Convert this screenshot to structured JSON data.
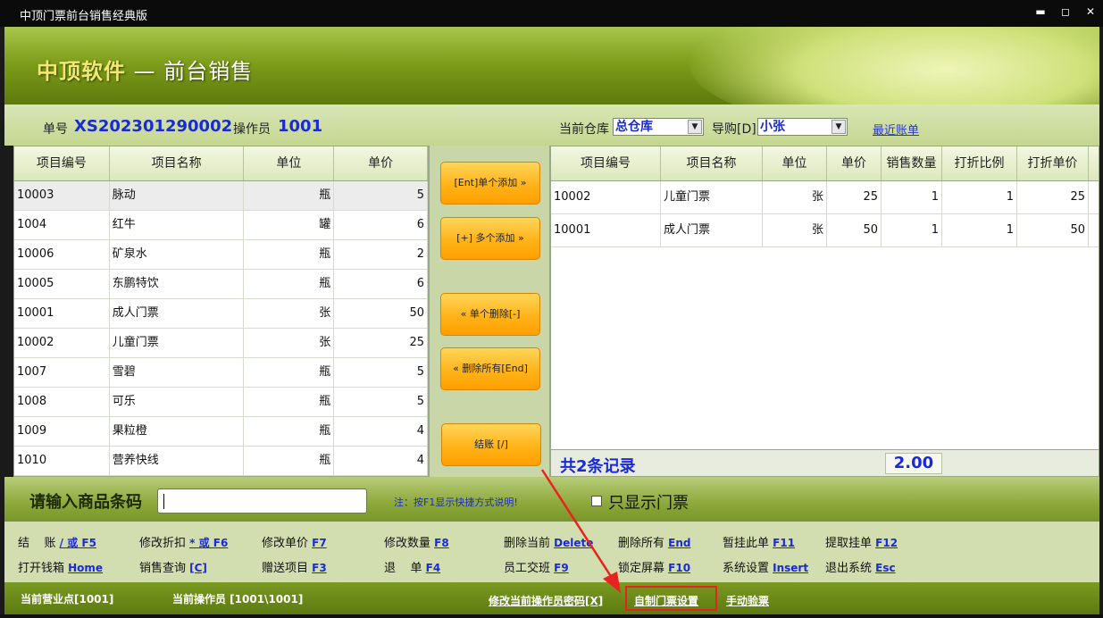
{
  "window": {
    "title": "中顶门票前台销售经典版",
    "buttons": [
      "▬",
      "◻",
      "✕"
    ]
  },
  "banner": {
    "logo_main": "中顶软件",
    "logo_sep": " — ",
    "logo_sub": "前台销售"
  },
  "info": {
    "order_label": "单号",
    "order_value": "XS202301290002",
    "operator_label": "操作员",
    "operator_value": "1001",
    "warehouse_label": "当前仓库",
    "warehouse_value": "总仓库",
    "guide_label": "导购[D]",
    "guide_value": "小张",
    "recent_link": "最近账单"
  },
  "left_grid": {
    "headers": [
      "项目编号",
      "项目名称",
      "单位",
      "单价"
    ],
    "rows": [
      [
        "10003",
        "脉动",
        "瓶",
        "5"
      ],
      [
        "1004",
        "红牛",
        "罐",
        "6"
      ],
      [
        "10006",
        "矿泉水",
        "瓶",
        "2"
      ],
      [
        "10005",
        "东鹏特饮",
        "瓶",
        "6"
      ],
      [
        "10001",
        "成人门票",
        "张",
        "50"
      ],
      [
        "10002",
        "儿童门票",
        "张",
        "25"
      ],
      [
        "1007",
        "雪碧",
        "瓶",
        "5"
      ],
      [
        "1008",
        "可乐",
        "瓶",
        "5"
      ],
      [
        "1009",
        "果粒橙",
        "瓶",
        "4"
      ],
      [
        "1010",
        "营养快线",
        "瓶",
        "4"
      ]
    ]
  },
  "mid_buttons": {
    "add_single": "[Ent]单个添加 »",
    "add_multi": "[+] 多个添加 »",
    "del_single": "« 单个删除[-]",
    "del_all": "« 删除所有[End]",
    "checkout": "结账 [/]"
  },
  "right_grid": {
    "headers": [
      "项目编号",
      "项目名称",
      "单位",
      "单价",
      "销售数量",
      "打折比例",
      "打折单价"
    ],
    "rows": [
      [
        "10002",
        "儿童门票",
        "张",
        "25",
        "1",
        "1",
        "25"
      ],
      [
        "10001",
        "成人门票",
        "张",
        "50",
        "1",
        "1",
        "50"
      ]
    ],
    "record_count": "共2条记录",
    "total": "2.00"
  },
  "barcode": {
    "label": "请输入商品条码",
    "value": "",
    "note": "注：按F1显示快捷方式说明!",
    "only_tickets_label": "只显示门票",
    "only_tickets_checked": false
  },
  "shortcuts": {
    "row1": [
      {
        "label": "结    账 ",
        "key": "/ 或 F5"
      },
      {
        "label": "修改折扣 ",
        "key": "* 或 F6"
      },
      {
        "label": "修改单价 ",
        "key": "F7"
      },
      {
        "label": "修改数量 ",
        "key": "F8"
      },
      {
        "label": "删除当前 ",
        "key": "Delete"
      },
      {
        "label": "删除所有 ",
        "key": "End"
      },
      {
        "label": "暂挂此单 ",
        "key": "F11"
      },
      {
        "label": "提取挂单 ",
        "key": "F12"
      }
    ],
    "row2": [
      {
        "label": "打开钱箱 ",
        "key": "Home"
      },
      {
        "label": "销售查询 ",
        "key": "[C]"
      },
      {
        "label": "赠送项目 ",
        "key": "F3"
      },
      {
        "label": "退    单 ",
        "key": "F4"
      },
      {
        "label": "员工交班 ",
        "key": "F9"
      },
      {
        "label": "锁定屏幕 ",
        "key": "F10"
      },
      {
        "label": "系统设置 ",
        "key": "Insert"
      },
      {
        "label": "退出系统 ",
        "key": "Esc"
      }
    ]
  },
  "status": {
    "shop": "当前营业点[1001]",
    "operator": "当前操作员 [1001\\1001]",
    "change_pwd": "修改当前操作员密码[X]",
    "ticket_settings": "自制门票设置",
    "manual_check": "手动验票"
  },
  "colors": {
    "accent_blue": "#1a2ad6",
    "highlight_red": "#e8231f",
    "button_orange": "#ffb319",
    "banner_green": "#7e9e1c"
  }
}
